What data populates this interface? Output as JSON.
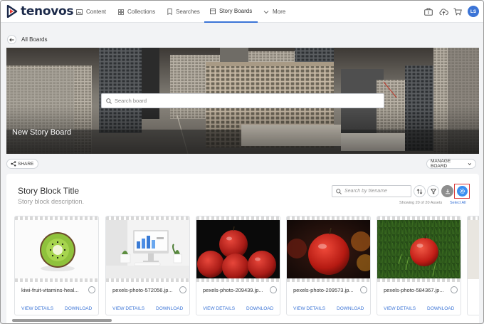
{
  "brand": {
    "name": "tenovos",
    "accent": "#3b74d6",
    "logo_color": "#1c2a4a"
  },
  "nav": {
    "items": [
      {
        "label": "Content",
        "icon": "image-icon"
      },
      {
        "label": "Collections",
        "icon": "grid-icon"
      },
      {
        "label": "Searches",
        "icon": "bookmark-icon"
      },
      {
        "label": "Story Boards",
        "icon": "storyboard-icon",
        "active": true
      },
      {
        "label": "More",
        "icon": "chevron-down-icon"
      }
    ],
    "right_icons": [
      "briefcase-icon",
      "upload-cloud-icon",
      "cart-icon"
    ],
    "avatar_initials": "LS"
  },
  "breadcrumb": {
    "back_label": "All Boards"
  },
  "banner": {
    "search_placeholder": "Search board",
    "title": "New Story Board"
  },
  "actions": {
    "share_label": "SHARE",
    "manage_label": "MANAGE BOARD"
  },
  "block": {
    "title": "Story Block Title",
    "description": "Story block description.",
    "filename_placeholder": "Search by filename",
    "showing_text": "Showing 20 of 20 Assets",
    "select_all_label": "Select All"
  },
  "cards": [
    {
      "filename": "kiwi-fruit-vitamins-heal...",
      "view_label": "VIEW DETAILS",
      "download_label": "DOWNLOAD"
    },
    {
      "filename": "pexels-photo-572056.jp...",
      "view_label": "VIEW DETAILS",
      "download_label": "DOWNLOAD"
    },
    {
      "filename": "pexels-photo-209439.jp...",
      "view_label": "VIEW DETAILS",
      "download_label": "DOWNLOAD"
    },
    {
      "filename": "pexels-photo-209573.jp...",
      "view_label": "VIEW DETAILS",
      "download_label": "DOWNLOAD"
    },
    {
      "filename": "pexels-photo-584367.jp...",
      "view_label": "VIEW DETAILS",
      "download_label": "DOWNLOAD"
    }
  ]
}
